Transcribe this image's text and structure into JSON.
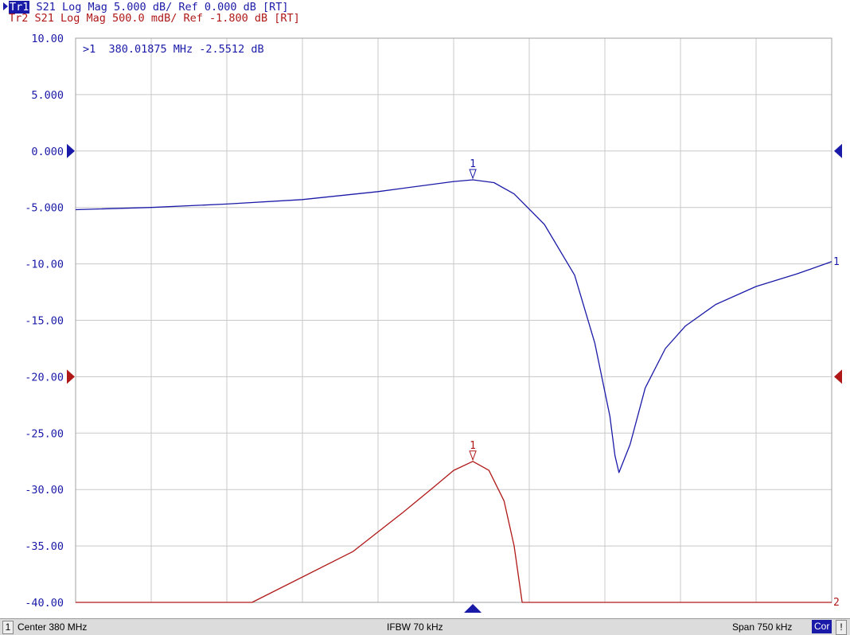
{
  "header": {
    "tr1": {
      "tag": "Tr1",
      "text": " S21 Log Mag 5.000 dB/ Ref 0.000 dB [RT]"
    },
    "tr2": {
      "tag": "Tr2",
      "text": " S21 Log Mag 500.0 mdB/ Ref -1.800 dB [RT]"
    }
  },
  "marker_readout": ">1  380.01875 MHz -2.5512 dB",
  "statusbar": {
    "channel": "1",
    "center": "Center 380 MHz",
    "ifbw": "IFBW 70 kHz",
    "span": "Span 750 kHz",
    "cor": "Cor",
    "excl": "!"
  },
  "colors": {
    "tr1": "#1a1aa8",
    "tr2": "#b01818",
    "grid": "#c8c8c8",
    "axis_text": "#1a1aa8"
  },
  "chart_data": {
    "type": "line",
    "x_unit": "MHz",
    "xlim": [
      379.625,
      380.375
    ],
    "ylim": [
      -40,
      10
    ],
    "y_ticks": [
      "10.00",
      "5.000",
      "0.000",
      "-5.000",
      "-10.00",
      "-15.00",
      "-20.00",
      "-25.00",
      "-30.00",
      "-35.00",
      "-40.00"
    ],
    "grid": true,
    "series": [
      {
        "name": "Tr1",
        "x": [
          379.625,
          379.7,
          379.775,
          379.85,
          379.925,
          380.0,
          380.019,
          380.04,
          380.06,
          380.09,
          380.12,
          380.14,
          380.155,
          380.16,
          380.164,
          380.175,
          380.19,
          380.21,
          380.23,
          380.26,
          380.3,
          380.34,
          380.375
        ],
        "y": [
          -5.2,
          -5.0,
          -4.7,
          -4.3,
          -3.6,
          -2.7,
          -2.55,
          -2.8,
          -3.8,
          -6.5,
          -11.0,
          -17.0,
          -23.5,
          -27.0,
          -28.5,
          -26.0,
          -21.0,
          -17.5,
          -15.5,
          -13.6,
          -12.0,
          -10.9,
          -9.8
        ]
      },
      {
        "name": "Tr2",
        "x": [
          379.625,
          379.8,
          379.9,
          379.95,
          379.98,
          380.0,
          380.019,
          380.035,
          380.05,
          380.06,
          380.068,
          380.08,
          380.375
        ],
        "y": [
          -40.0,
          -40.0,
          -35.5,
          -32.0,
          -29.8,
          -28.3,
          -27.5,
          -28.3,
          -31.0,
          -35.0,
          -40.0,
          -40.0,
          -40.0
        ]
      }
    ],
    "markers": [
      {
        "series": "Tr1",
        "label": "1",
        "x": 380.019,
        "y": -2.55
      },
      {
        "series": "Tr2",
        "label": "1",
        "x": 380.019,
        "y": -27.5
      }
    ],
    "right_edge_labels": [
      {
        "series": "Tr1",
        "label": "1"
      },
      {
        "series": "Tr2",
        "label": "2"
      }
    ],
    "reference_levels": [
      {
        "series": "Tr1",
        "y": 0
      },
      {
        "series": "Tr2",
        "y": -20
      }
    ]
  }
}
